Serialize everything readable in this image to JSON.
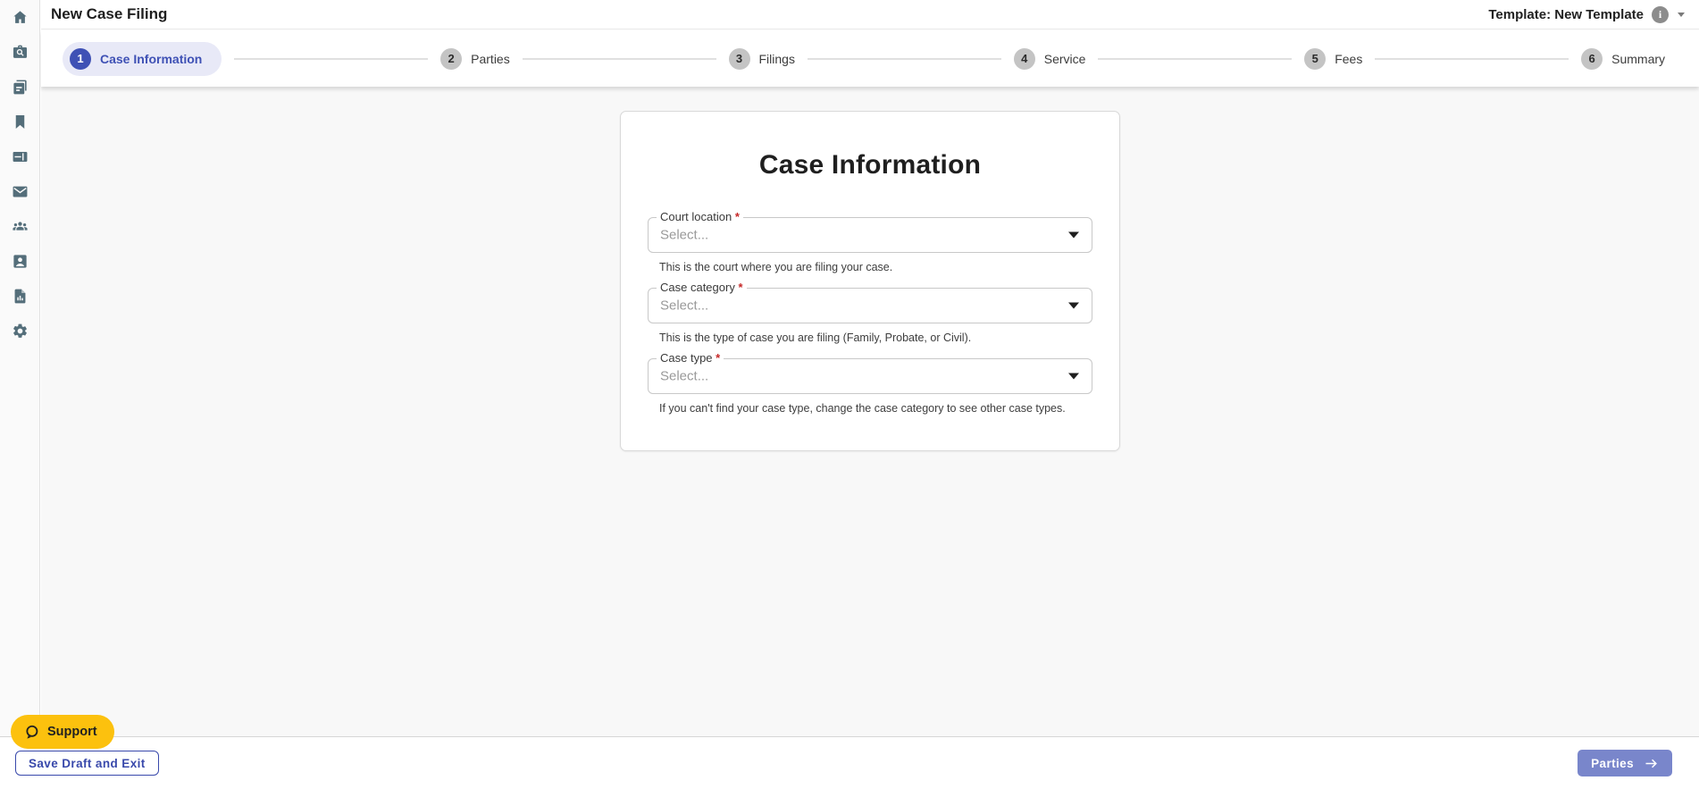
{
  "header": {
    "title": "New Case Filing",
    "template_label": "Template: New Template",
    "info_glyph": "i"
  },
  "sidebar": {
    "icons": [
      "home-icon",
      "case-search-icon",
      "filings-icon",
      "bookmark-icon",
      "payment-icon",
      "mail-icon",
      "parties-icon",
      "contacts-icon",
      "reports-icon",
      "settings-icon"
    ]
  },
  "stepper": {
    "steps": [
      {
        "num": "1",
        "label": "Case Information",
        "state": "active"
      },
      {
        "num": "2",
        "label": "Parties",
        "state": "inactive"
      },
      {
        "num": "3",
        "label": "Filings",
        "state": "inactive"
      },
      {
        "num": "4",
        "label": "Service",
        "state": "inactive"
      },
      {
        "num": "5",
        "label": "Fees",
        "state": "inactive"
      },
      {
        "num": "6",
        "label": "Summary",
        "state": "inactive"
      }
    ]
  },
  "form": {
    "title": "Case Information",
    "required_marker": "*",
    "fields": [
      {
        "label": "Court location",
        "placeholder": "Select...",
        "helper": "This is the court where you are filing your case."
      },
      {
        "label": "Case category",
        "placeholder": "Select...",
        "helper": "This is the type of case you are filing (Family, Probate, or Civil)."
      },
      {
        "label": "Case type",
        "placeholder": "Select...",
        "helper": "If you can't find your case type, change the case category to see other case types."
      }
    ]
  },
  "footer": {
    "save_label": "Save Draft and Exit",
    "next_label": "Parties"
  },
  "support": {
    "label": "Support"
  },
  "colors": {
    "accent_indigo": "#3f51b5",
    "active_pill_bg": "#e8e9f7",
    "next_button_indigo": "#7986cb",
    "support_yellow": "#fcc10e",
    "required_red": "#c62828",
    "rail_icon_gray": "#546e7a"
  }
}
